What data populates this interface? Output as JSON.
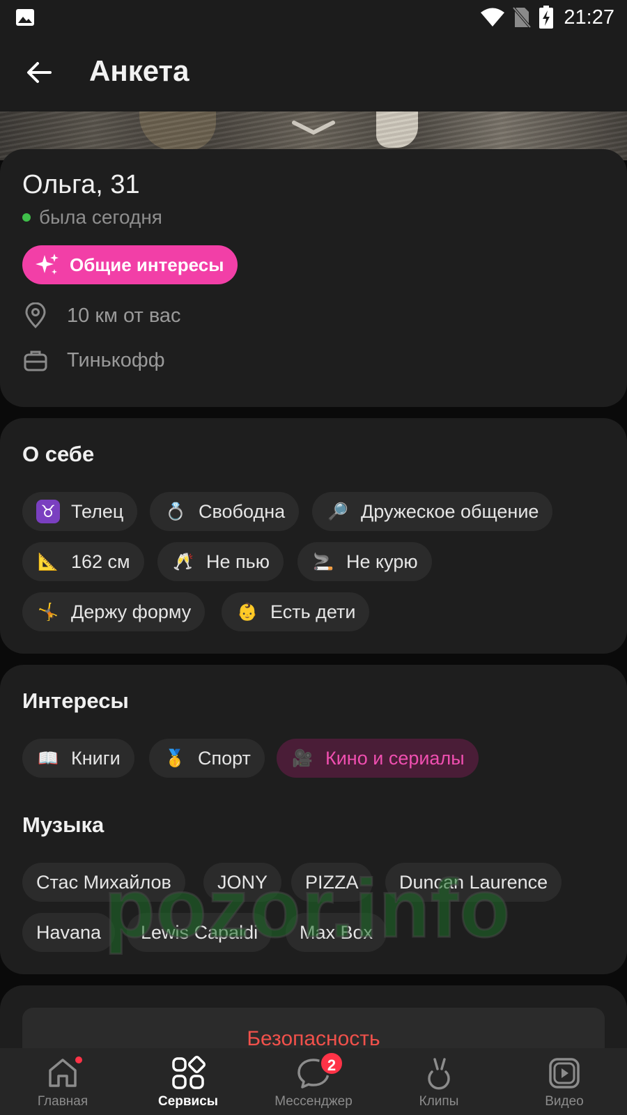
{
  "status_bar": {
    "time": "21:27",
    "icons": [
      "image-icon",
      "wifi-icon",
      "no-sim-icon",
      "battery-charging-icon"
    ]
  },
  "header": {
    "title": "Анкета",
    "back_icon": "arrow-left-icon"
  },
  "profile": {
    "name_age": "Ольга, 31",
    "last_seen": "была сегодня",
    "common_interests_label": "Общие интересы",
    "distance": "10 км от вас",
    "work": "Тинькофф"
  },
  "about": {
    "title": "О себе",
    "chips": [
      {
        "emoji": "♉",
        "label": "Телец"
      },
      {
        "emoji": "💍",
        "label": "Свободна"
      },
      {
        "emoji": "🔎",
        "label": "Дружеское общение"
      },
      {
        "emoji": "📐",
        "label": "162 см"
      },
      {
        "emoji": "🥂",
        "label": "Не пью"
      },
      {
        "emoji": "🚬",
        "label": "Не курю"
      },
      {
        "emoji": "🤸",
        "label": "Держу форму"
      },
      {
        "emoji": "👶",
        "label": "Есть дети"
      }
    ]
  },
  "interests": {
    "title": "Интересы",
    "chips": [
      {
        "emoji": "📖",
        "label": "Книги"
      },
      {
        "emoji": "🥇",
        "label": "Спорт"
      },
      {
        "emoji": "🎥",
        "label": "Кино и сериалы"
      }
    ]
  },
  "music": {
    "title": "Музыка",
    "chips": [
      "Стас Михайлов",
      "JONY",
      "PIZZA",
      "Duncan Laurence",
      "Havana",
      "Lewis Capaldi",
      "Max Box"
    ]
  },
  "safety": {
    "button_label": "Безопасность"
  },
  "watermark": "pozor.info",
  "tabbar": {
    "items": [
      {
        "label": "Главная",
        "icon": "home-icon"
      },
      {
        "label": "Сервисы",
        "icon": "services-icon"
      },
      {
        "label": "Мессенджер",
        "icon": "chat-icon",
        "badge": "2"
      },
      {
        "label": "Клипы",
        "icon": "clips-icon"
      },
      {
        "label": "Видео",
        "icon": "video-icon"
      }
    ]
  },
  "colors": {
    "accent": "#f23fa7",
    "danger": "#f0514b",
    "online": "#3fbf4a",
    "badge": "#ff3347"
  }
}
